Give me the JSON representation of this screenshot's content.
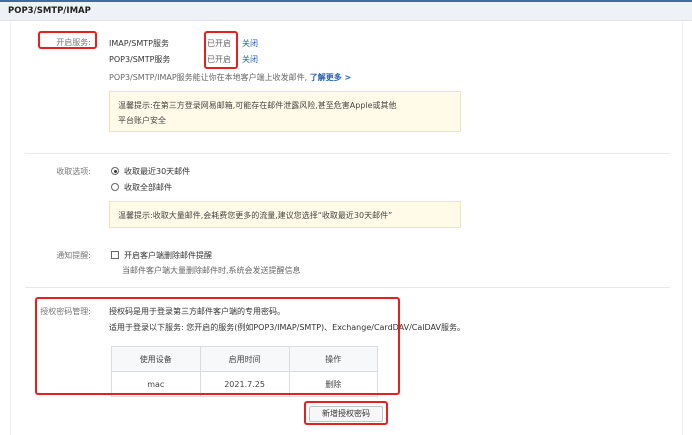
{
  "header": {
    "title": "POP3/SMTP/IMAP"
  },
  "service": {
    "label": "开启服务:",
    "rows": [
      {
        "name": "IMAP/SMTP服务",
        "status": "已开启",
        "separator": "|",
        "action": "关闭"
      },
      {
        "name": "POP3/SMTP服务",
        "status": "已开启",
        "separator": "|",
        "action": "关闭"
      }
    ],
    "desc": "POP3/SMTP/IMAP服务能让你在本地客户端上收发邮件,",
    "more_link": "了解更多 >",
    "tip_line1": "温馨提示:在第三方登录网易邮箱,可能存在邮件泄露风险,甚至危害Apple或其他",
    "tip_line2": "平台账户安全"
  },
  "receive": {
    "label": "收取选项:",
    "option_recent": "收取最近30天邮件",
    "option_all": "收取全部邮件",
    "selected": "recent",
    "tip": "温馨提示:收取大量邮件,会耗费您更多的流量,建议您选择“收取最近30天邮件”"
  },
  "notify": {
    "label": "通知提醒:",
    "checkbox_label": "开启客户端删除邮件提醒",
    "checked": false,
    "sub": "当邮件客户端大量删除邮件时,系统会发送提醒信息"
  },
  "auth": {
    "label": "授权密码管理:",
    "line1": "授权码是用于登录第三方邮件客户端的专用密码。",
    "line2": "适用于登录以下服务: 您开启的服务(例如POP3/IMAP/SMTP)、Exchange/CardDAV/CalDAV服务。",
    "table": {
      "headers": [
        "使用设备",
        "启用时间",
        "操作"
      ],
      "rows": [
        {
          "device": "mac",
          "date": "2021.7.25",
          "action": "删除"
        }
      ]
    },
    "add_button": "新增授权密码"
  },
  "colors": {
    "accent_link": "#2262b8",
    "highlight_red": "#e8201b",
    "note_bg": "#fffbe8"
  }
}
